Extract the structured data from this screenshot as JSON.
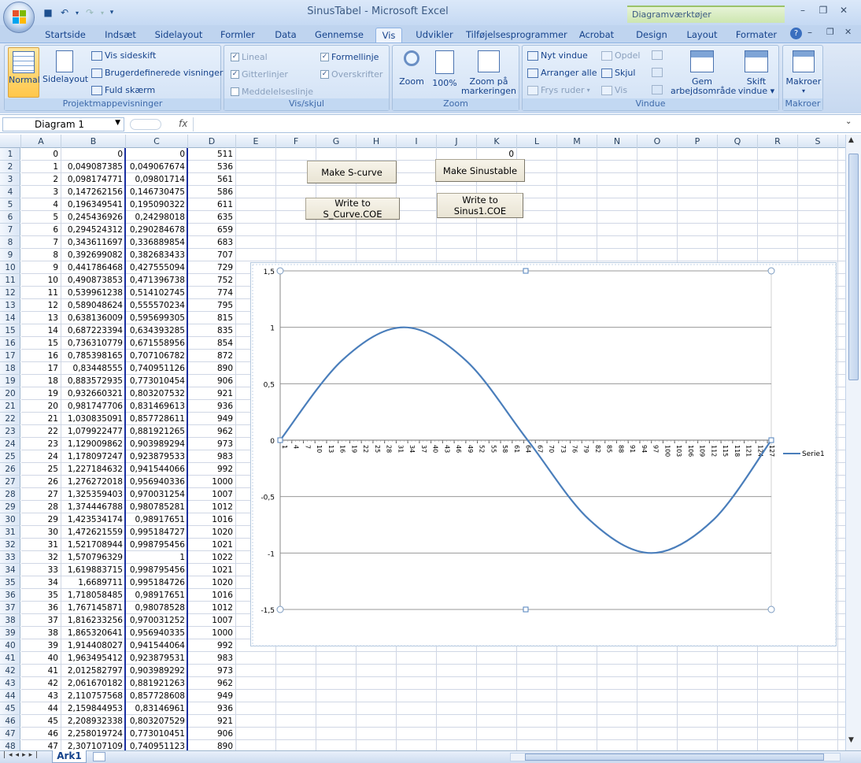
{
  "window": {
    "title": "SinusTabel - Microsoft Excel",
    "context_tab_title": "Diagramværktøjer",
    "minimize": "–",
    "restore": "❐",
    "close": "✕"
  },
  "tabs": [
    "Startside",
    "Indsæt",
    "Sidelayout",
    "Formler",
    "Data",
    "Gennemse",
    "Vis",
    "Udvikler",
    "Tilføjelsesprogrammer",
    "Acrobat",
    "Design",
    "Layout",
    "Formater"
  ],
  "active_tab": "Vis",
  "ribbon": {
    "group1": {
      "label": "Projektmappevisninger",
      "normal": "Normal",
      "sidelayout": "Sidelayout",
      "vis_sideskift": "Vis sideskift",
      "brugerdef": "Brugerdefinerede visninger",
      "fuld": "Fuld skærm"
    },
    "group2": {
      "label": "Vis/skjul",
      "lineal": "Lineal",
      "gitterlinjer": "Gitterlinjer",
      "meddelelseslinje": "Meddelelseslinje",
      "formellinje": "Formellinje",
      "overskrifter": "Overskrifter"
    },
    "group3": {
      "label": "Zoom",
      "zoom": "Zoom",
      "pct": "100%",
      "zoom_markering_1": "Zoom på",
      "zoom_markering_2": "markeringen"
    },
    "group4": {
      "label": "Vindue",
      "nyt": "Nyt vindue",
      "arranger": "Arranger alle",
      "frys": "Frys ruder",
      "opdel": "Opdel",
      "skjul": "Skjul",
      "vis": "Vis",
      "gem_1": "Gem",
      "gem_2": "arbejdsområde",
      "skift_1": "Skift",
      "skift_2": "vindue"
    },
    "group5": {
      "label": "Makroer",
      "makroer": "Makroer"
    }
  },
  "formula_bar": {
    "name_box": "Diagram 1",
    "fx": "fx",
    "value": ""
  },
  "columns": [
    "A",
    "B",
    "C",
    "D",
    "E",
    "F",
    "G",
    "H",
    "I",
    "J",
    "K",
    "L",
    "M",
    "N",
    "O",
    "P",
    "Q",
    "R",
    "S"
  ],
  "rows": [
    [
      "0",
      "0",
      "0",
      "511"
    ],
    [
      "1",
      "0,049087385",
      "0,049067674",
      "536"
    ],
    [
      "2",
      "0,098174771",
      "0,09801714",
      "561"
    ],
    [
      "3",
      "0,147262156",
      "0,146730475",
      "586"
    ],
    [
      "4",
      "0,196349541",
      "0,195090322",
      "611"
    ],
    [
      "5",
      "0,245436926",
      "0,24298018",
      "635"
    ],
    [
      "6",
      "0,294524312",
      "0,290284678",
      "659"
    ],
    [
      "7",
      "0,343611697",
      "0,336889854",
      "683"
    ],
    [
      "8",
      "0,392699082",
      "0,382683433",
      "707"
    ],
    [
      "9",
      "0,441786468",
      "0,427555094",
      "729"
    ],
    [
      "10",
      "0,490873853",
      "0,471396738",
      "752"
    ],
    [
      "11",
      "0,539961238",
      "0,514102745",
      "774"
    ],
    [
      "12",
      "0,589048624",
      "0,555570234",
      "795"
    ],
    [
      "13",
      "0,638136009",
      "0,595699305",
      "815"
    ],
    [
      "14",
      "0,687223394",
      "0,634393285",
      "835"
    ],
    [
      "15",
      "0,736310779",
      "0,671558956",
      "854"
    ],
    [
      "16",
      "0,785398165",
      "0,707106782",
      "872"
    ],
    [
      "17",
      "0,83448555",
      "0,740951126",
      "890"
    ],
    [
      "18",
      "0,883572935",
      "0,773010454",
      "906"
    ],
    [
      "19",
      "0,932660321",
      "0,803207532",
      "921"
    ],
    [
      "20",
      "0,981747706",
      "0,831469613",
      "936"
    ],
    [
      "21",
      "1,030835091",
      "0,857728611",
      "949"
    ],
    [
      "22",
      "1,079922477",
      "0,881921265",
      "962"
    ],
    [
      "23",
      "1,129009862",
      "0,903989294",
      "973"
    ],
    [
      "24",
      "1,178097247",
      "0,923879533",
      "983"
    ],
    [
      "25",
      "1,227184632",
      "0,941544066",
      "992"
    ],
    [
      "26",
      "1,276272018",
      "0,956940336",
      "1000"
    ],
    [
      "27",
      "1,325359403",
      "0,970031254",
      "1007"
    ],
    [
      "28",
      "1,374446788",
      "0,980785281",
      "1012"
    ],
    [
      "29",
      "1,423534174",
      "0,98917651",
      "1016"
    ],
    [
      "30",
      "1,472621559",
      "0,995184727",
      "1020"
    ],
    [
      "31",
      "1,521708944",
      "0,998795456",
      "1021"
    ],
    [
      "32",
      "1,570796329",
      "1",
      "1022"
    ],
    [
      "33",
      "1,619883715",
      "0,998795456",
      "1021"
    ],
    [
      "34",
      "1,6689711",
      "0,995184726",
      "1020"
    ],
    [
      "35",
      "1,718058485",
      "0,98917651",
      "1016"
    ],
    [
      "36",
      "1,767145871",
      "0,98078528",
      "1012"
    ],
    [
      "37",
      "1,816233256",
      "0,970031252",
      "1007"
    ],
    [
      "38",
      "1,865320641",
      "0,956940335",
      "1000"
    ],
    [
      "39",
      "1,914408027",
      "0,941544064",
      "992"
    ],
    [
      "40",
      "1,963495412",
      "0,923879531",
      "983"
    ],
    [
      "41",
      "2,012582797",
      "0,903989292",
      "973"
    ],
    [
      "42",
      "2,061670182",
      "0,881921263",
      "962"
    ],
    [
      "43",
      "2,110757568",
      "0,857728608",
      "949"
    ],
    [
      "44",
      "2,159844953",
      "0,83146961",
      "936"
    ],
    [
      "45",
      "2,208932338",
      "0,803207529",
      "921"
    ],
    [
      "46",
      "2,258019724",
      "0,773010451",
      "906"
    ],
    [
      "47",
      "2,307107109",
      "0,740951123",
      "890"
    ]
  ],
  "cell_k1": "0",
  "buttons": {
    "s_curve": "Make S-curve",
    "sinustable": "Make Sinustable",
    "write_s": "Write  to S_Curve.COE",
    "write_sin_1": "Write  to",
    "write_sin_2": "Sinus1.COE"
  },
  "sheet_tab": "Ark1",
  "chart_data": {
    "type": "line",
    "title": "",
    "xlabel": "",
    "ylabel": "",
    "x_range": [
      1,
      128
    ],
    "x_tick_labels": [
      "1",
      "4",
      "7",
      "10",
      "13",
      "16",
      "19",
      "22",
      "25",
      "28",
      "31",
      "34",
      "37",
      "40",
      "43",
      "46",
      "49",
      "52",
      "55",
      "58",
      "61",
      "64",
      "67",
      "70",
      "73",
      "76",
      "79",
      "82",
      "85",
      "88",
      "91",
      "94",
      "97",
      "100",
      "103",
      "106",
      "109",
      "112",
      "115",
      "118",
      "121",
      "124",
      "127"
    ],
    "ylim": [
      -1.5,
      1.5
    ],
    "y_tick_labels": [
      "1,5",
      "1",
      "0,5",
      "0",
      "-0,5",
      "-1",
      "-1,5"
    ],
    "grid": true,
    "legend": "right",
    "series": [
      {
        "name": "Serie1",
        "x": [
          1,
          17,
          33,
          49,
          65,
          81,
          97,
          113,
          128
        ],
        "y": [
          0,
          0.707,
          1,
          0.707,
          0,
          -0.707,
          -1,
          -0.707,
          0
        ],
        "color": "#4a7ebb"
      }
    ]
  }
}
